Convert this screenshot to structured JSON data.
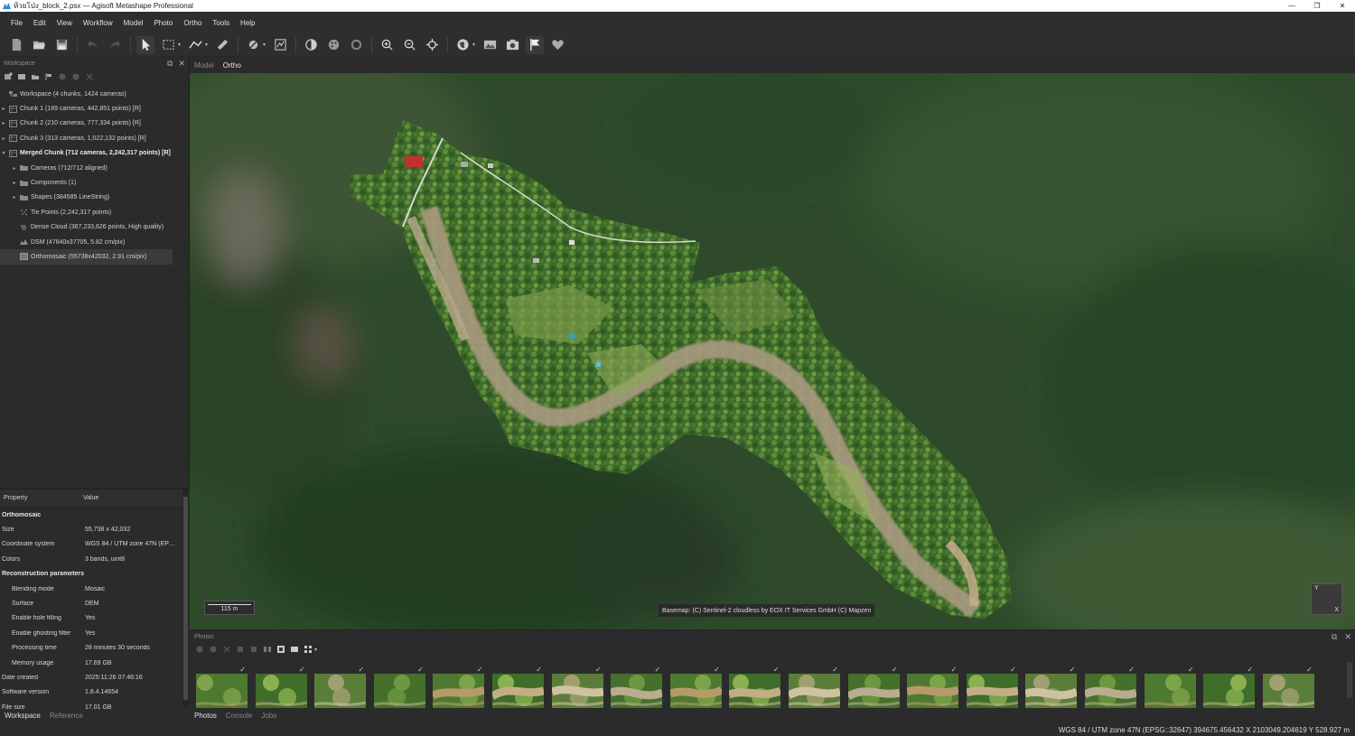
{
  "window": {
    "title": "ห้วยโป่ง_block_2.psx — Agisoft Metashape Professional",
    "minimize": "—",
    "maximize": "❐",
    "close": "✕"
  },
  "menu": [
    {
      "id": "file",
      "label": "File"
    },
    {
      "id": "edit",
      "label": "Edit"
    },
    {
      "id": "view",
      "label": "View"
    },
    {
      "id": "workflow",
      "label": "Workflow"
    },
    {
      "id": "model",
      "label": "Model"
    },
    {
      "id": "photo",
      "label": "Photo"
    },
    {
      "id": "ortho",
      "label": "Ortho"
    },
    {
      "id": "tools",
      "label": "Tools"
    },
    {
      "id": "help",
      "label": "Help"
    }
  ],
  "toolbar_icons": [
    "new-icon",
    "open-icon",
    "save-icon",
    "undo-icon",
    "redo-icon",
    "navigation-icon",
    "rectangle-selection-icon",
    "draw-polyline-icon",
    "ruler-icon",
    "seamline-icon",
    "patch-icon",
    "brightness-icon",
    "color-palette-icon",
    "rotate-icon",
    "zoom-in-icon",
    "zoom-out-icon",
    "reset-view-icon",
    "globe-icon",
    "show-ortho-icon",
    "camera-icon",
    "flag-icon",
    "heart-shape-icon"
  ],
  "workspace": {
    "header": "Workspace",
    "tree": [
      {
        "label": "Workspace (4 chunks, 1424 cameras)",
        "level": 0,
        "icon": "workspace-icon",
        "arrow": ""
      },
      {
        "label": "Chunk 1 (189 cameras, 442,851 points) [R]",
        "level": 0,
        "icon": "chunk-icon",
        "arrow": "▸"
      },
      {
        "label": "Chunk 2 (210 cameras, 777,334 points) [R]",
        "level": 0,
        "icon": "chunk-icon",
        "arrow": "▸"
      },
      {
        "label": "Chunk 3 (313 cameras, 1,022,132 points) [R]",
        "level": 0,
        "icon": "chunk-icon",
        "arrow": "▸"
      },
      {
        "label": "Merged Chunk (712 cameras, 2,242,317 points) [R]",
        "level": 0,
        "icon": "chunk-icon",
        "arrow": "▾",
        "bold": true
      },
      {
        "label": "Cameras (712/712 aligned)",
        "level": 1,
        "icon": "folder-icon",
        "arrow": "▸"
      },
      {
        "label": "Components (1)",
        "level": 1,
        "icon": "folder-icon",
        "arrow": "▸"
      },
      {
        "label": "Shapes (384585 LineString)",
        "level": 1,
        "icon": "folder-icon",
        "arrow": "▸"
      },
      {
        "label": "Tie Points (2,242,317 points)",
        "level": 1,
        "icon": "tie-points-icon",
        "arrow": ""
      },
      {
        "label": "Dense Cloud (367,233,626 points, High quality)",
        "level": 1,
        "icon": "dense-cloud-icon",
        "arrow": ""
      },
      {
        "label": "DSM (47840x37705, 5.82 cm/pix)",
        "level": 1,
        "icon": "dsm-icon",
        "arrow": ""
      },
      {
        "label": "Orthomosaic (55738x42032, 2.91 cm/pix)",
        "level": 1,
        "icon": "orthomosaic-icon",
        "arrow": "",
        "selected": true
      }
    ]
  },
  "properties": {
    "col_property": "Property",
    "col_value": "Value",
    "rows": [
      {
        "key": "Orthomosaic",
        "value": "",
        "type": "group"
      },
      {
        "key": "Size",
        "value": "55,738 x 42,032",
        "type": "item"
      },
      {
        "key": "Coordinate system",
        "value": "WGS 84 / UTM zone 47N (EPSG::32647)",
        "type": "item"
      },
      {
        "key": "Colors",
        "value": "3 bands, uint8",
        "type": "item"
      },
      {
        "key": "Reconstruction parameters",
        "value": "",
        "type": "group"
      },
      {
        "key": "Blending mode",
        "value": "Mosaic",
        "type": "sub"
      },
      {
        "key": "Surface",
        "value": "DEM",
        "type": "sub"
      },
      {
        "key": "Enable hole filling",
        "value": "Yes",
        "type": "sub"
      },
      {
        "key": "Enable ghosting filter",
        "value": "Yes",
        "type": "sub"
      },
      {
        "key": "Processing time",
        "value": "28 minutes 30 seconds",
        "type": "sub"
      },
      {
        "key": "Memory usage",
        "value": "17.69 GB",
        "type": "sub"
      },
      {
        "key": "Date created",
        "value": "2025:11:26 07:46:16",
        "type": "item"
      },
      {
        "key": "Software version",
        "value": "1.8.4.14654",
        "type": "item"
      },
      {
        "key": "File size",
        "value": "17.01 GB",
        "type": "item"
      }
    ]
  },
  "left_tabs": [
    {
      "label": "Workspace",
      "active": true
    },
    {
      "label": "Reference",
      "active": false
    }
  ],
  "view_tabs": [
    {
      "label": "Model",
      "active": false
    },
    {
      "label": "Ortho",
      "active": true
    }
  ],
  "viewport": {
    "scale_label": "115 m",
    "basemap_credit": "Basemap: (C) Sentinel-2 cloudless by EOX IT Services GmbH (C) Mapzen",
    "axis_y": "Y",
    "axis_x": "X"
  },
  "photos": {
    "header": "Photos",
    "check": "✓",
    "thumb_count": 19
  },
  "bottom_tabs": [
    {
      "label": "Photos",
      "active": true
    },
    {
      "label": "Console",
      "active": false
    },
    {
      "label": "Jobs",
      "active": false
    }
  ],
  "status": {
    "text": "WGS 84 / UTM zone 47N (EPSG::32647)  394675.456432 X  2103049.204619 Y  528.927 m"
  },
  "colors": {
    "background": "#2b2b2b",
    "selection": "#3b3b3b",
    "forest_dark": "#2f4a2c"
  }
}
